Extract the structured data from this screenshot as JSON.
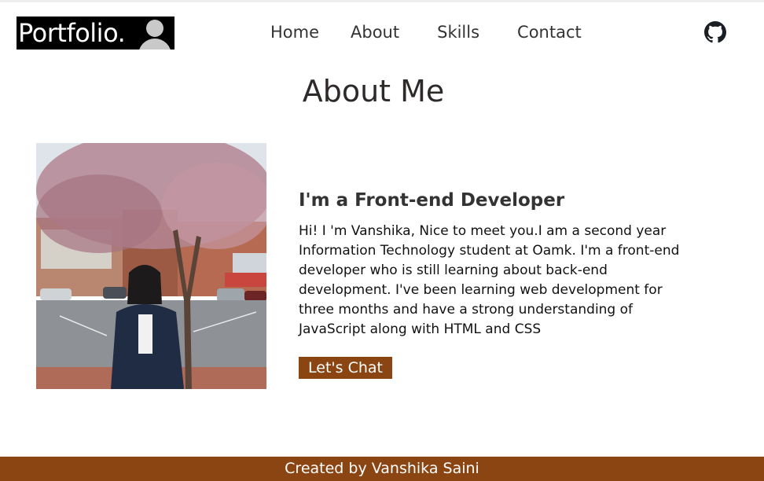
{
  "header": {
    "logo_text": "Portfolio.",
    "nav": [
      "Home",
      "About",
      "Skills",
      "Contact"
    ],
    "github_icon": "github-icon"
  },
  "about": {
    "title": "About Me",
    "subtitle": "I'm a Front-end Developer",
    "bio": "Hi! I 'm Vanshika, Nice to meet you.I am a second year Information Technology student at Oamk. I'm a front-end developer who is still learning about back-end development. I've been learning web development for three months and have a strong understanding of JavaScript along with HTML and CSS",
    "button_label": "Let's Chat"
  },
  "footer": {
    "text": "Created by Vanshika Saini"
  },
  "colors": {
    "accent": "#8b4513",
    "logo_bg": "#000000"
  }
}
